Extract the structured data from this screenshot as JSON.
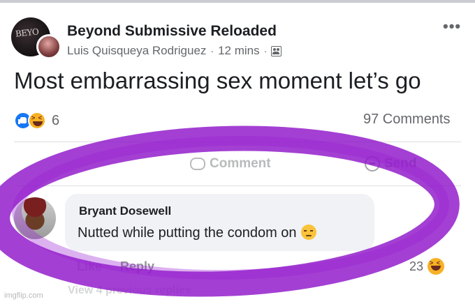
{
  "post": {
    "group_name": "Beyond Submissive Reloaded",
    "group_avatar_text": "BEYO",
    "author": "Luis Quisqueya Rodriguez",
    "time": "12 mins",
    "separator": "·",
    "more_label": "•••",
    "text": "Most embarrassing sex moment let’s go",
    "reaction_count": "6",
    "comments_count": "97 Comments"
  },
  "actions": {
    "comment_label": "Comment",
    "send_label": "Send"
  },
  "comment": {
    "author": "Bryant Dosewell",
    "text": "Nutted while putting the condom on",
    "like_label": "Like",
    "reply_label": "Reply",
    "reaction_count": "23",
    "view_previous": "View 4 previous replies"
  },
  "watermark": "imgflip.com",
  "colors": {
    "marker": "#8f16c9",
    "like_blue": "#1877f2",
    "haha_yellow": "#f7b125",
    "muted_text": "#65676b"
  },
  "icons": [
    "like-icon",
    "haha-icon",
    "comment-icon",
    "send-icon",
    "group-icon",
    "pensive-emoji"
  ]
}
